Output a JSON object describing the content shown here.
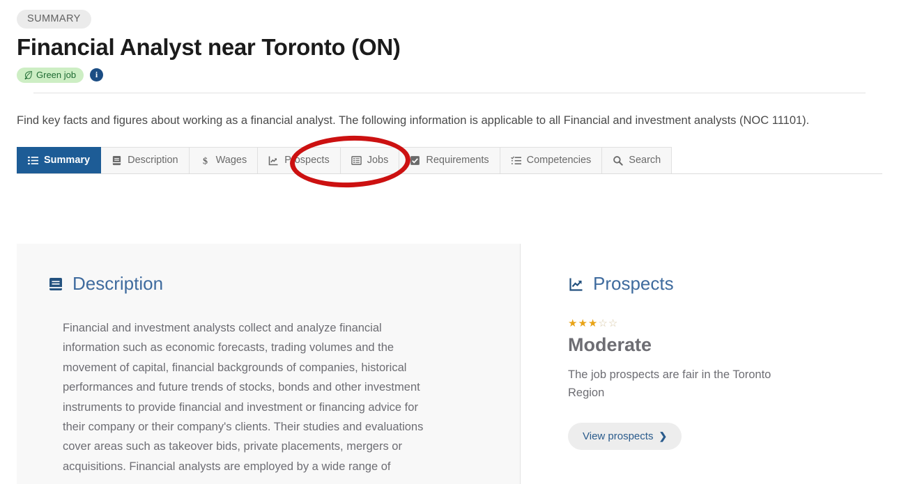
{
  "header": {
    "eyebrow": "SUMMARY",
    "title": "Financial Analyst near Toronto (ON)",
    "green_badge": "Green job",
    "info_glyph": "i"
  },
  "intro": "Find key facts and figures about working as a financial analyst. The following information is applicable to all Financial and investment analysts (NOC 11101).",
  "tabs": [
    {
      "label": "Summary",
      "icon": "list-icon",
      "active": true
    },
    {
      "label": "Description",
      "icon": "book-icon",
      "active": false
    },
    {
      "label": "Wages",
      "icon": "dollar-icon",
      "active": false
    },
    {
      "label": "Prospects",
      "icon": "chart-line-icon",
      "active": false
    },
    {
      "label": "Jobs",
      "icon": "list-box-icon",
      "active": false
    },
    {
      "label": "Requirements",
      "icon": "checkbox-icon",
      "active": false
    },
    {
      "label": "Competencies",
      "icon": "task-list-icon",
      "active": false
    },
    {
      "label": "Search",
      "icon": "magnifier-icon",
      "active": false
    }
  ],
  "annotation": {
    "shape": "red-ellipse",
    "target": "Prospects",
    "color": "#cc1111"
  },
  "description": {
    "heading": "Description",
    "body": "Financial and investment analysts collect and analyze financial information such as economic forecasts, trading volumes and the movement of capital, financial backgrounds of companies, historical performances and future trends of stocks, bonds and other investment instruments to provide financial and investment or financing advice for their company or their company's clients. Their studies and evaluations cover areas such as takeover bids, private placements, mergers or acquisitions. Financial analysts are employed by a wide range of"
  },
  "prospects": {
    "heading": "Prospects",
    "stars_filled": 3,
    "stars_total": 5,
    "rating_label": "Moderate",
    "rating_description": "The job prospects are fair in the Toronto Region",
    "button_label": "View prospects",
    "button_chevron": "❯"
  },
  "colors": {
    "active_tab": "#1d5c96",
    "heading_blue": "#3f6b9e",
    "green_badge_bg": "#cdeec4",
    "star_gold": "#e8a317",
    "annotation_red": "#cc1111"
  }
}
